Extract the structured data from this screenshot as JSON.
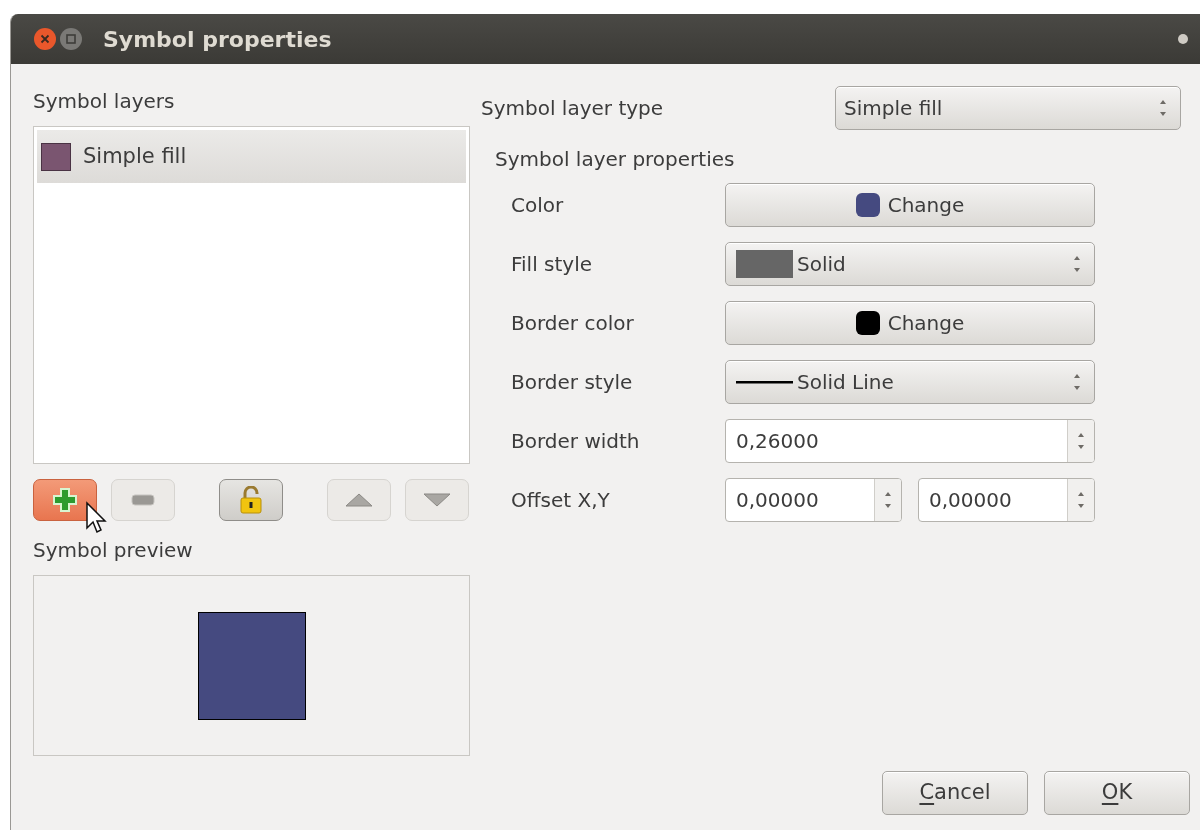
{
  "window": {
    "title": "Symbol properties"
  },
  "symbol_layers": {
    "label": "Symbol layers",
    "items": [
      {
        "name": "Simple fill",
        "color": "#7a5570",
        "selected": true
      }
    ]
  },
  "layer_buttons": [
    {
      "kind": "add",
      "highlighted": true
    },
    {
      "kind": "remove",
      "highlighted": false
    },
    {
      "kind": "lock",
      "highlighted": false
    },
    {
      "kind": "up",
      "highlighted": false
    },
    {
      "kind": "down",
      "highlighted": false
    }
  ],
  "symbol_preview": {
    "label": "Symbol preview",
    "color": "#454a80"
  },
  "symbol_layer_type": {
    "label": "Symbol layer type",
    "value": "Simple fill"
  },
  "properties": {
    "label": "Symbol layer properties",
    "rows": [
      {
        "kind": "color",
        "label": "Color",
        "value": "Change",
        "color": "#454a80"
      },
      {
        "kind": "fill_combo",
        "label": "Fill style",
        "value": "Solid"
      },
      {
        "kind": "color",
        "label": "Border color",
        "value": "Change",
        "color": "#000000"
      },
      {
        "kind": "line_combo",
        "label": "Border style",
        "value": "Solid Line"
      },
      {
        "kind": "spin",
        "label": "Border width",
        "value": "0,26000"
      },
      {
        "kind": "spin_pair",
        "label": "Offset X,Y",
        "values": [
          "0,00000",
          "0,00000"
        ]
      }
    ]
  },
  "buttons": [
    {
      "label": "Cancel"
    },
    {
      "label": "OK"
    }
  ]
}
